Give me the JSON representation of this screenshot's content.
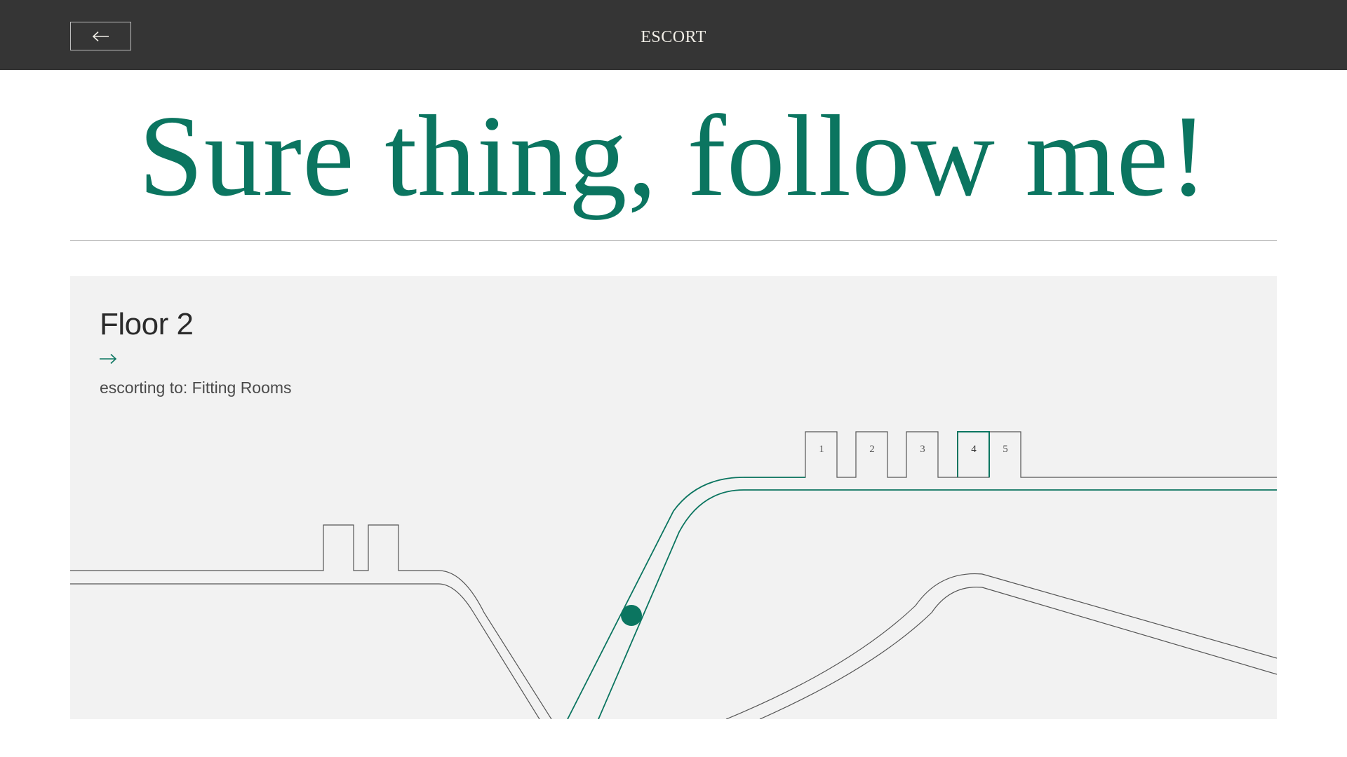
{
  "header": {
    "title": "ESCORT",
    "back_icon": "arrow-left-icon"
  },
  "headline": "Sure thing, follow me!",
  "floor": {
    "title": "Floor 2",
    "arrow_icon": "arrow-right-icon",
    "destination_text": "escorting to: Fitting Rooms"
  },
  "map": {
    "rooms": [
      "1",
      "2",
      "3",
      "4",
      "5"
    ],
    "active_room": "4"
  },
  "colors": {
    "accent": "#0b7560",
    "header_bg": "#353535",
    "panel_bg": "#f2f2f2",
    "line": "#555555"
  }
}
